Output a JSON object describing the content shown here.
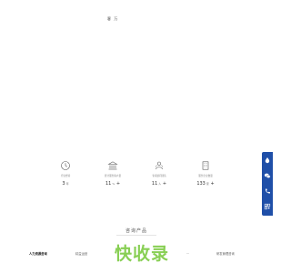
{
  "header": {
    "top_text": "客 万"
  },
  "stats": [
    {
      "label": "行业经验",
      "value": "3",
      "unit": "年",
      "suffix": ""
    },
    {
      "label": "累计服务客户量",
      "value": "11",
      "unit": "%",
      "suffix": "+"
    },
    {
      "label": "专家顾问团队",
      "value": "11",
      "unit": "人",
      "suffix": "+"
    },
    {
      "label": "服务企业数量",
      "value": "133",
      "unit": "家",
      "suffix": "+"
    }
  ],
  "section": {
    "title": "咨询产品"
  },
  "tabs": [
    "人力资源咨询",
    "精益运营",
    "…",
    "研发管理咨询"
  ],
  "watermark": {
    "text": "快收录"
  },
  "colors": {
    "accent": "#1f4fa8",
    "watermark": "#7cc83c"
  }
}
